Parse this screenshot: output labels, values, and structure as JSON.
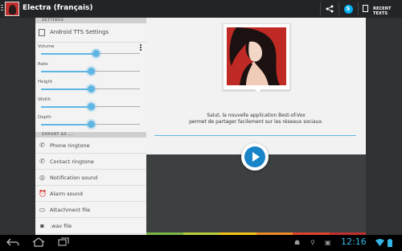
{
  "app": {
    "title": "Electra (français)"
  },
  "actionbar": {
    "share_icon": "share-icon",
    "skype_icon": "skype-icon",
    "recent_texts_label": "RECENT TEXTS"
  },
  "settings": {
    "header": "SETTINGS",
    "tts_label": "Android TTS Settings",
    "sliders": [
      {
        "label": "Volume",
        "value": 0.55
      },
      {
        "label": "Rate",
        "value": 0.5
      },
      {
        "label": "Height",
        "value": 0.5
      },
      {
        "label": "Width",
        "value": 0.5
      },
      {
        "label": "Depth",
        "value": 0.5
      }
    ]
  },
  "export": {
    "header": "EXPORT AS ...",
    "items": [
      {
        "label": "Phone ringtone",
        "icon": "phone-icon"
      },
      {
        "label": "Contact ringtone",
        "icon": "phone-contact-icon"
      },
      {
        "label": "Notification sound",
        "icon": "globe-icon"
      },
      {
        "label": "Alarm sound",
        "icon": "alarm-clock-icon"
      },
      {
        "label": "Attachment file",
        "icon": "attachment-icon"
      },
      {
        "label": ".wav file",
        "icon": "disk-icon"
      }
    ]
  },
  "card": {
    "line1": "Salut, la nouvelle application Best-of-Vox",
    "line2": "permet de partager facilement sur les réseaux sociaux."
  },
  "statusbar": {
    "time": "12:16"
  },
  "colors": {
    "accent": "#5fb6e3",
    "play": "#1a84c8",
    "strip": [
      "#7ab648",
      "#b9cf3a",
      "#f5c21b",
      "#f08a24",
      "#e1432c",
      "#c0302e"
    ]
  }
}
